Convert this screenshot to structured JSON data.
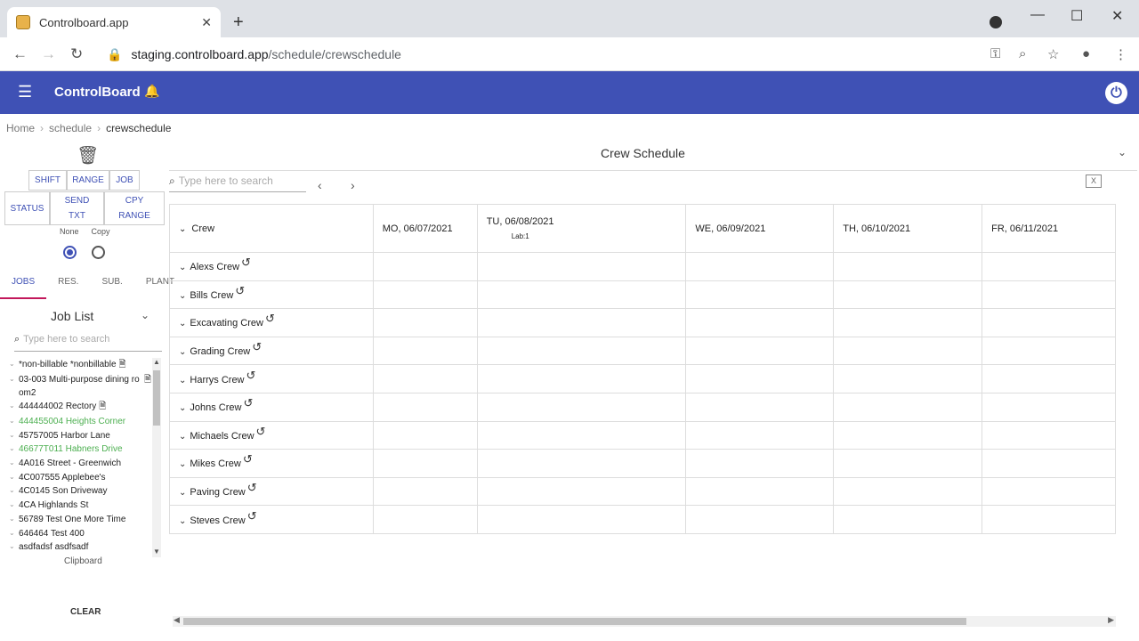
{
  "browser": {
    "tab_title": "Controlboard.app",
    "url_host": "staging.controlboard.app",
    "url_path": "/schedule/crewschedule"
  },
  "appbar": {
    "brand": "ControlBoard",
    "accent": "#3f51b5"
  },
  "breadcrumb": {
    "home": "Home",
    "schedule": "schedule",
    "current": "crewschedule"
  },
  "left": {
    "buttons_row1": [
      "SHIFT",
      "RANGE",
      "JOB"
    ],
    "status": "STATUS",
    "send_txt_1": "SEND",
    "send_txt_2": "TXT",
    "cpy_range_1": "CPY",
    "cpy_range_2": "RANGE",
    "radio_none": "None",
    "radio_copy": "Copy",
    "tabs": [
      "JOBS",
      "RES.",
      "SUB.",
      "PLANT"
    ],
    "joblist_title": "Job List",
    "search_placeholder": "Type here to search",
    "jobs": [
      {
        "label": "*non-billable *nonbillable",
        "doc": true,
        "green": false
      },
      {
        "label": "03-003 Multi-purpose dining ro om2",
        "doc": true,
        "green": false
      },
      {
        "label": "444444002 Rectory",
        "doc": true,
        "green": false
      },
      {
        "label": "444455004 Heights Corner",
        "doc": false,
        "green": true
      },
      {
        "label": "45757005 Harbor Lane",
        "doc": false,
        "green": false
      },
      {
        "label": "46677T011 Habners Drive",
        "doc": false,
        "green": true
      },
      {
        "label": "4A016 Street - Greenwich",
        "doc": false,
        "green": false
      },
      {
        "label": "4C007555 Applebee's",
        "doc": false,
        "green": false
      },
      {
        "label": "4C0145 Son Driveway",
        "doc": false,
        "green": false
      },
      {
        "label": "4CA Highlands St",
        "doc": false,
        "green": false
      },
      {
        "label": "56789 Test One More Time",
        "doc": false,
        "green": false
      },
      {
        "label": "646464 Test 400",
        "doc": false,
        "green": false
      },
      {
        "label": "asdfadsf asdfsadf",
        "doc": false,
        "green": false
      }
    ],
    "clipboard": "Clipboard",
    "clear": "CLEAR"
  },
  "main": {
    "title": "Crew Schedule",
    "search_placeholder": "Type here to search",
    "col_crew": "Crew",
    "days": [
      "MO, 06/07/2021",
      "TU, 06/08/2021",
      "WE, 06/09/2021",
      "TH, 06/10/2021",
      "FR, 06/11/2021"
    ],
    "tu_sub": "Lab:1",
    "crews": [
      "Alexs Crew",
      "Bills Crew",
      "Excavating Crew",
      "Grading Crew",
      "Harrys Crew",
      "Johns Crew",
      "Michaels Crew",
      "Mikes Crew",
      "Paving Crew",
      "Steves Crew"
    ]
  }
}
